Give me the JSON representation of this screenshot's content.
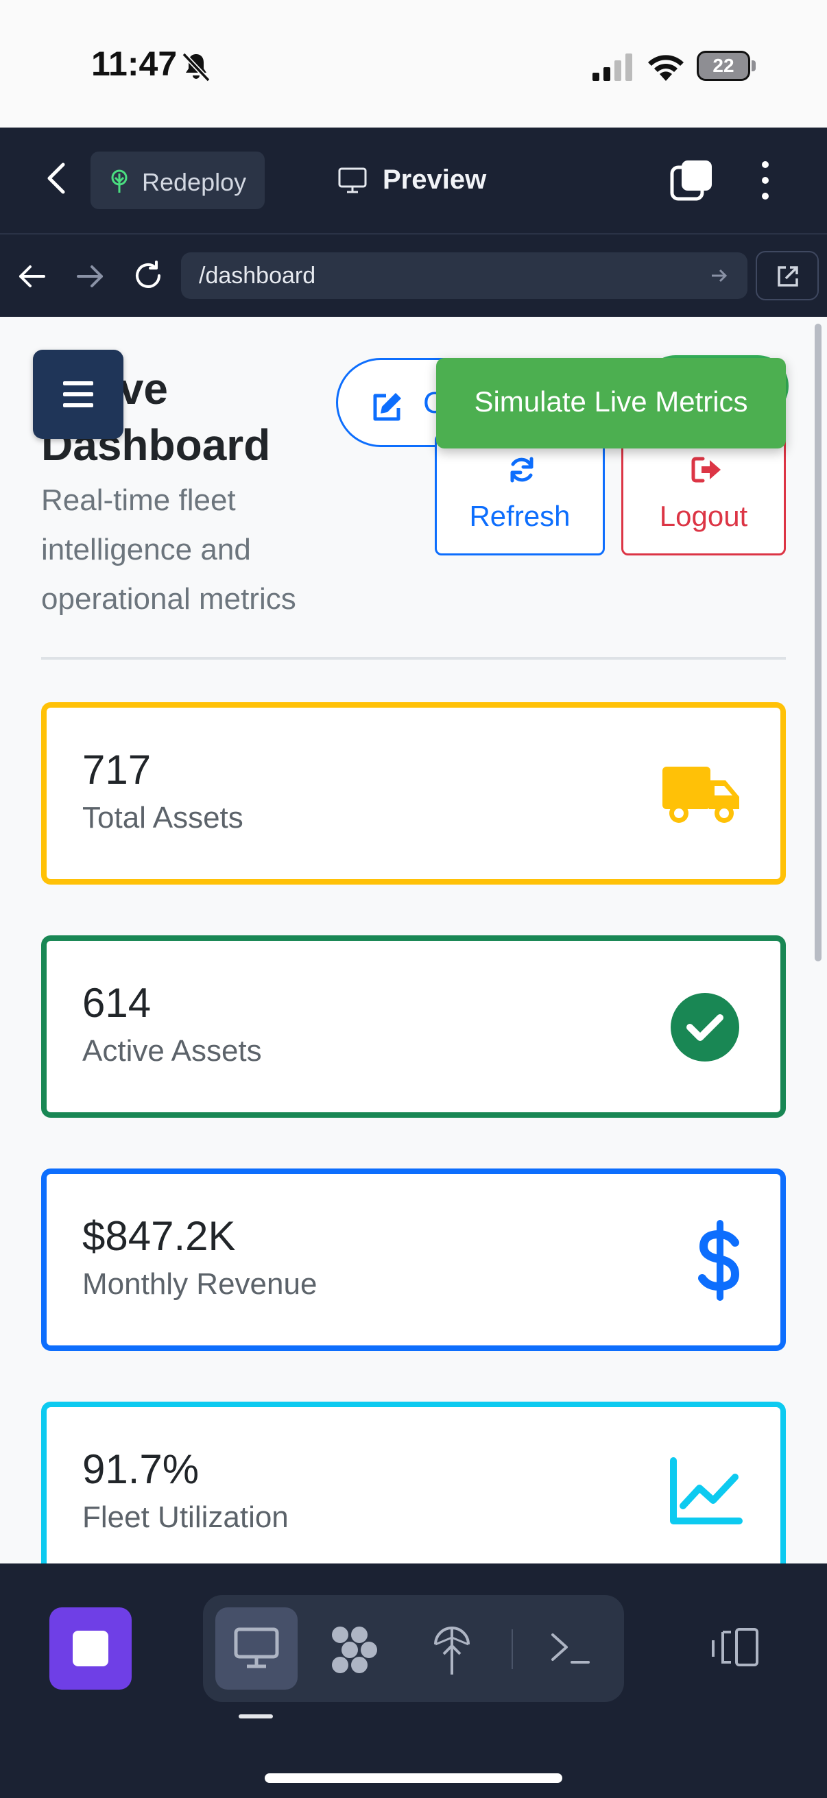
{
  "status_bar": {
    "time": "11:47",
    "battery": "22"
  },
  "toolbar": {
    "redeploy_label": "Redeploy",
    "preview_label": "Preview"
  },
  "url_bar": {
    "path": "/dashboard"
  },
  "header": {
    "title_line1": "cutive",
    "title_line2": "Dashboard",
    "subtitle": "Real-time fleet intelligence and operational metrics",
    "oval_button_label": "C",
    "refresh_label": "Refresh",
    "logout_label": "Logout"
  },
  "toast": {
    "text": "Simulate Live Metrics"
  },
  "stats": [
    {
      "value": "717",
      "label": "Total Assets",
      "icon": "truck-icon",
      "color": "#ffc107"
    },
    {
      "value": "614",
      "label": "Active Assets",
      "icon": "check-circle-icon",
      "color": "#198754"
    },
    {
      "value": "$847.2K",
      "label": "Monthly Revenue",
      "icon": "dollar-icon",
      "color": "#0d6efd"
    },
    {
      "value": "91.7%",
      "label": "Fleet Utilization",
      "icon": "chart-line-icon",
      "color": "#0dcaf0"
    }
  ],
  "colors": {
    "topbar_bg": "#1b2233",
    "toast_bg": "#4caf50",
    "app_button": "#6f3fe6",
    "menu_button": "#1f3558"
  },
  "bottom_tools": [
    "monitor-icon",
    "cluster-icon",
    "deploy-icon",
    "terminal-icon"
  ]
}
